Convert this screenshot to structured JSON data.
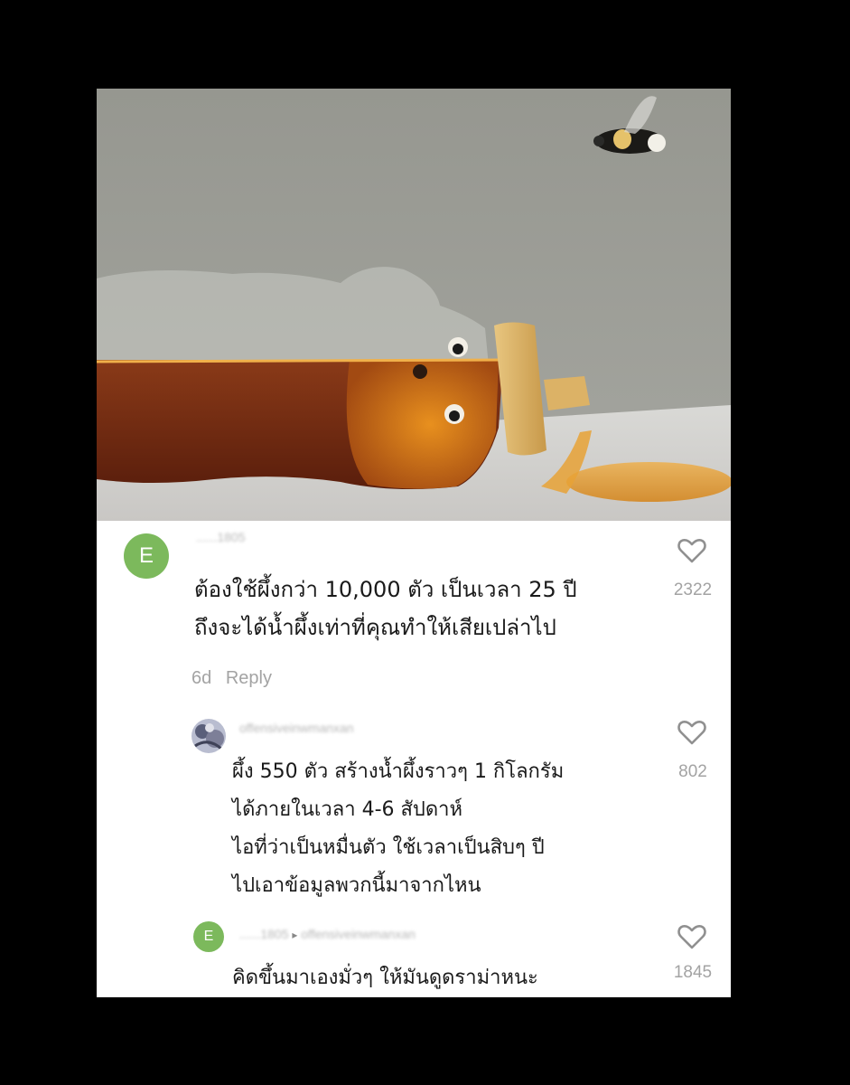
{
  "post": {
    "image_icon": "honey-bear-bottle-with-bee"
  },
  "comments": [
    {
      "avatar_letter": "E",
      "username": "......1805",
      "text": "ต้องใช้ผึ้งกว่า 10,000 ตัว เป็นเวลา 25 ปี\nถึงจะได้น้ำผึ้งเท่าที่คุณทำให้เสียเปล่าไป",
      "likes": "2322",
      "age": "6d",
      "reply_label": "Reply"
    },
    {
      "avatar_icon": "profile-photo",
      "username": "offensiveinwmanxan",
      "text": "ผึ้ง 550 ตัว สร้างน้ำผึ้งราวๆ 1 กิโลกรัม\nได้ภายในเวลา 4-6 สัปดาห์\nไอที่ว่าเป็นหมื่นตัว ใช้เวลาเป็นสิบๆ ปี\nไปเอาข้อมูลพวกนี้มาจากไหน",
      "likes": "802"
    },
    {
      "avatar_letter": "E",
      "username": "......1805",
      "reply_to": "offensiveinwmanxan",
      "text": "คิดขึ้นมาเองมั่วๆ ให้มันดูดราม่าหนะ",
      "likes": "1845"
    }
  ],
  "colors": {
    "background": "#000000",
    "card": "#ffffff",
    "avatar_green": "#7cb95c",
    "muted_text": "#a3a3a3"
  }
}
